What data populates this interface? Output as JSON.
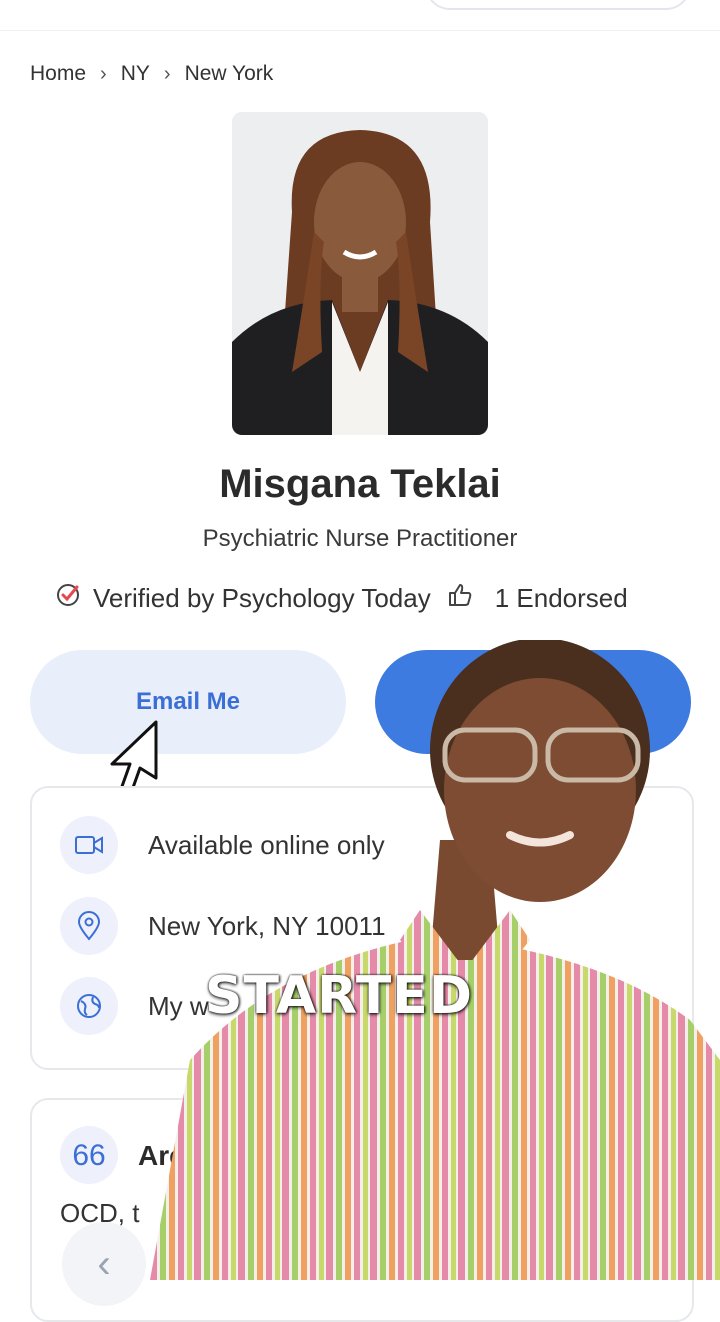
{
  "breadcrumb": [
    "Home",
    "NY",
    "New York"
  ],
  "profile": {
    "name": "Misgana Teklai",
    "title": "Psychiatric Nurse Practitioner",
    "verified_text": "Verified by Psychology Today",
    "endorsed_text": "1 Endorsed"
  },
  "actions": {
    "email_label": "Email Me"
  },
  "info": {
    "online": "Available online only",
    "location": "New York, NY 10011",
    "website_partial": "My w"
  },
  "areas": {
    "title": "Are",
    "text_partial": "OCD, t"
  },
  "caption": "STARTED",
  "colors": {
    "accent": "#3d7be0",
    "email_bg": "#e8effb",
    "verified_check": "#e5484d"
  }
}
